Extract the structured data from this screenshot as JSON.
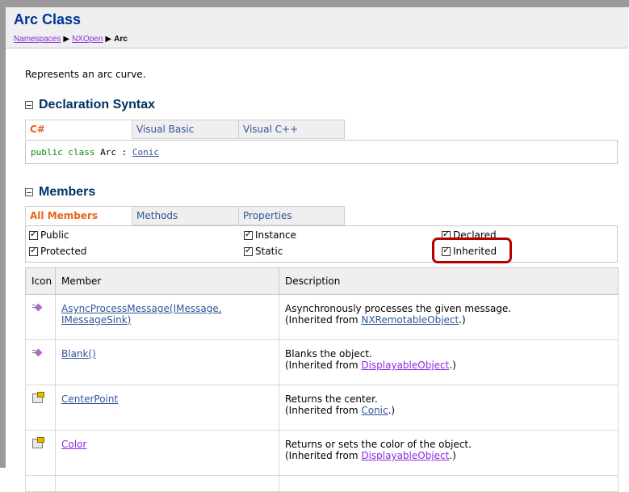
{
  "header": {
    "title": "Arc Class",
    "breadcrumb": {
      "item1": "Namespaces",
      "sep": "▶",
      "item2": "NXOpen",
      "current": "Arc"
    }
  },
  "summary": "Represents an arc curve.",
  "declaration": {
    "heading": "Declaration Syntax",
    "tabs": [
      "C#",
      "Visual Basic",
      "Visual C++"
    ],
    "code_keywords": "public class",
    "code_name": "Arc",
    "code_colon": ":",
    "code_base": "Conic"
  },
  "members": {
    "heading": "Members",
    "tabs": [
      "All Members",
      "Methods",
      "Properties"
    ],
    "filters": {
      "public": "Public",
      "protected": "Protected",
      "instance": "Instance",
      "static": "Static",
      "declared": "Declared",
      "inherited": "Inherited"
    },
    "columns": [
      "Icon",
      "Member",
      "Description"
    ],
    "rows": [
      {
        "icon": "method-icon",
        "member": "AsyncProcessMessage(IMessage, IMessageSink)",
        "desc": "Asynchronously processes the given message.",
        "inh_prefix": "(Inherited from ",
        "inh_class": "NXRemotableObject",
        "inh_suffix": ".)"
      },
      {
        "icon": "method-icon",
        "member": "Blank()",
        "desc": "Blanks the object.",
        "inh_prefix": "(Inherited from ",
        "inh_class": "DisplayableObject",
        "inh_suffix": ".)"
      },
      {
        "icon": "property-icon",
        "member": "CenterPoint",
        "desc": "Returns the center.",
        "inh_prefix": "(Inherited from ",
        "inh_class": "Conic",
        "inh_suffix": ".)"
      },
      {
        "icon": "property-icon",
        "member": "Color",
        "desc": "Returns or sets the color of the object.",
        "inh_prefix": "(Inherited from ",
        "inh_class": "DisplayableObject",
        "inh_suffix": ".)"
      }
    ]
  }
}
